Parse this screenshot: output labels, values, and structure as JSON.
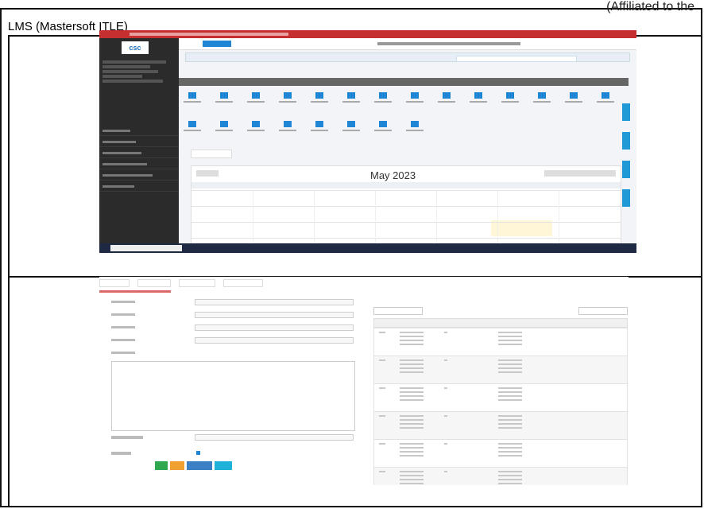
{
  "document": {
    "heading": "LMS (Mastersoft ITLE)",
    "cut_text": "(Affiliated to the"
  },
  "shot1": {
    "calendar_title": "May 2023",
    "icon_count": 22,
    "sidebar_items": 6,
    "calendar_rows": 4,
    "colors": {
      "browser_bar": "#c62f2f",
      "sidebar": "#2b2b2b",
      "accent": "#1f86d6",
      "taskbar": "#1e2a44"
    }
  },
  "shot2": {
    "tab_count": 4,
    "form_fields": 5,
    "table_rows": 6,
    "buttons": [
      {
        "color": "#2fa84f"
      },
      {
        "color": "#f0a030"
      },
      {
        "color": "#3b7fc4"
      },
      {
        "color": "#1fb1d8"
      }
    ]
  }
}
